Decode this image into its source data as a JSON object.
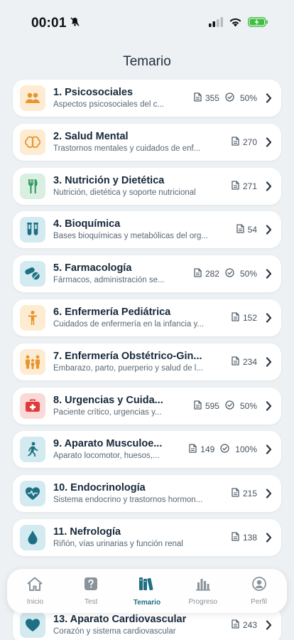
{
  "status": {
    "time": "00:01"
  },
  "header": {
    "title": "Temario"
  },
  "topics": [
    {
      "title": "1. Psicosociales",
      "subtitle": "Aspectos psicosociales del c...",
      "count": "355",
      "progress": "50%",
      "icon": "people-icon",
      "bg": "#fdecd2",
      "fg": "#e8952f"
    },
    {
      "title": "2. Salud Mental",
      "subtitle": "Trastornos mentales y cuidados de enf...",
      "count": "270",
      "progress": "",
      "icon": "brain-icon",
      "bg": "#fdecd2",
      "fg": "#e8952f"
    },
    {
      "title": "3. Nutrición y Dietética",
      "subtitle": "Nutrición, dietética y soporte nutricional",
      "count": "271",
      "progress": "",
      "icon": "utensils-icon",
      "bg": "#d8efe2",
      "fg": "#2f9a5c"
    },
    {
      "title": "4. Bioquímica",
      "subtitle": "Bases bioquímicas y metabólicas del org...",
      "count": "54",
      "progress": "",
      "icon": "test-tubes-icon",
      "bg": "#d3eaf0",
      "fg": "#1e6f84"
    },
    {
      "title": "5. Farmacología",
      "subtitle": "Fármacos, administración se...",
      "count": "282",
      "progress": "50%",
      "icon": "pills-icon",
      "bg": "#d3eaf0",
      "fg": "#1e6f84"
    },
    {
      "title": "6. Enfermería Pediátrica",
      "subtitle": "Cuidados de enfermería en la infancia y...",
      "count": "152",
      "progress": "",
      "icon": "child-icon",
      "bg": "#fdecd2",
      "fg": "#e8952f"
    },
    {
      "title": "7. Enfermería Obstétrico-Gin...",
      "subtitle": "Embarazo, parto, puerperio y salud de l...",
      "count": "234",
      "progress": "",
      "icon": "family-icon",
      "bg": "#fdecd2",
      "fg": "#e8952f"
    },
    {
      "title": "8. Urgencias y Cuida...",
      "subtitle": "Paciente crítico, urgencias y...",
      "count": "595",
      "progress": "50%",
      "icon": "first-aid-kit-icon",
      "bg": "#fbd9d9",
      "fg": "#e03a3a"
    },
    {
      "title": "9. Aparato Musculoe...",
      "subtitle": "Aparato locomotor, huesos,...",
      "count": "149",
      "progress": "100%",
      "icon": "walking-icon",
      "bg": "#d3eaf0",
      "fg": "#1e6f84"
    },
    {
      "title": "10. Endocrinología",
      "subtitle": "Sistema endocrino y trastornos hormon...",
      "count": "215",
      "progress": "",
      "icon": "heart-pulse-icon",
      "bg": "#d3eaf0",
      "fg": "#1e6f84"
    },
    {
      "title": "11. Nefrología",
      "subtitle": "Riñón, vías urinarias y función renal",
      "count": "138",
      "progress": "",
      "icon": "drop-icon",
      "bg": "#d3eaf0",
      "fg": "#1e6f84"
    }
  ],
  "bottom_topic": {
    "title": "13. Aparato Cardiovascular",
    "subtitle": "Corazón y sistema cardiovascular",
    "count": "243",
    "icon": "heart-icon",
    "bg": "#d3eaf0",
    "fg": "#1e6f84"
  },
  "tabs": [
    {
      "label": "Inicio",
      "icon": "home-icon",
      "active": false
    },
    {
      "label": "Test",
      "icon": "question-icon",
      "active": false
    },
    {
      "label": "Temario",
      "icon": "books-icon",
      "active": true
    },
    {
      "label": "Progreso",
      "icon": "bar-chart-icon",
      "active": false
    },
    {
      "label": "Perfil",
      "icon": "user-icon",
      "active": false
    }
  ],
  "colors": {
    "accent": "#1e6f84",
    "background": "#eef1f3",
    "battery": "#3fbf3f"
  }
}
